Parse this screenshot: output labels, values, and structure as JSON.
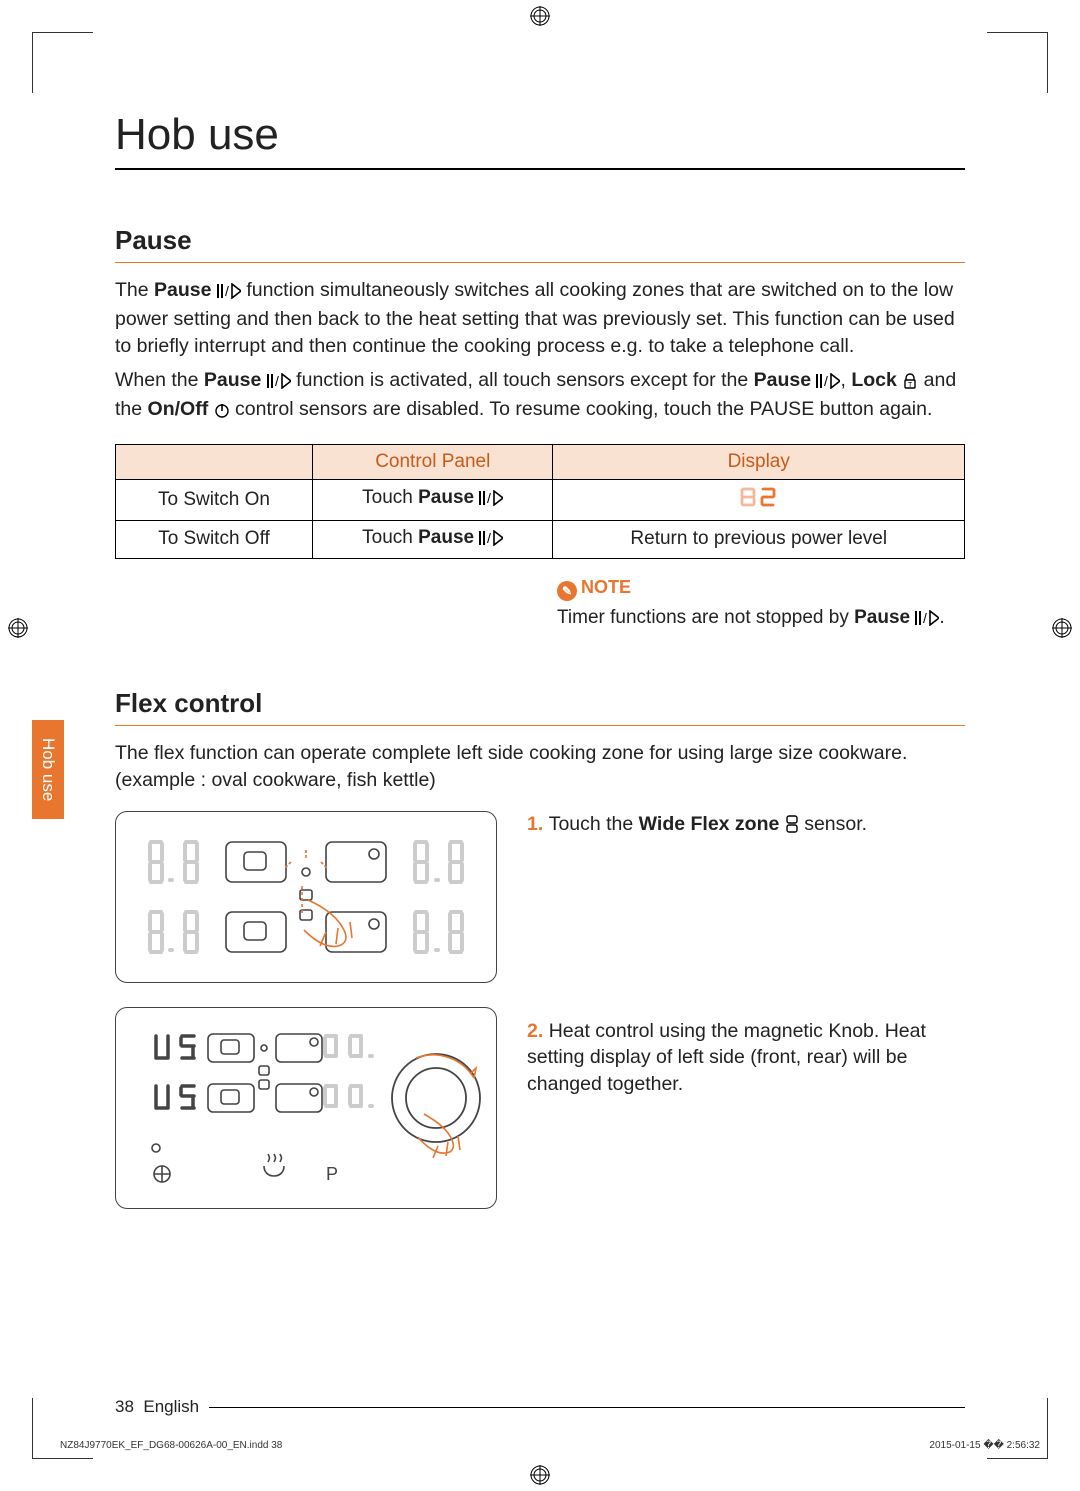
{
  "title": "Hob use",
  "sections": {
    "pause": {
      "heading": "Pause",
      "p1a": "The ",
      "p1b": "Pause",
      " p1c": " function simultaneously switches all cooking zones that are switched on to the low power setting and then back to the heat setting that was previously set. This function can be used to briefly interrupt and then continue the cooking process e.g. to take a telephone call.",
      "p2a": "When the ",
      "p2b": "Pause",
      "p2c": " function is activated, all touch sensors except for the ",
      "p2d": "Pause",
      "p2e": ", ",
      "p2f": "Lock",
      "p2g": " and the ",
      "p2h": "On/Off",
      "p2i": " control sensors are disabled. To resume cooking, touch the PAUSE button again.",
      "table": {
        "h1": "Control Panel",
        "h2": "Display",
        "r1c1": "To Switch On",
        "r1c2a": "Touch ",
        "r1c2b": "Pause",
        "r1c3": "",
        "r2c1": "To Switch Off",
        "r2c2a": "Touch ",
        "r2c2b": "Pause",
        "r2c3": "Return to previous power level"
      },
      "note_label": "NOTE",
      "note_a": "Timer functions are not stopped by ",
      "note_b": "Pause",
      "note_c": "."
    },
    "flex": {
      "heading": "Flex control",
      "p1": "The flex function can operate complete left side cooking zone for using large size cookware. (example : oval cookware, fish kettle)",
      "step1_num": "1.",
      "step1a": "Touch the ",
      "step1b": "Wide Flex zone",
      "step1c": " sensor.",
      "step2_num": "2.",
      "step2": "Heat control using the magnetic Knob. Heat setting display of left side (front, rear) will be changed together."
    }
  },
  "tab": "Hob use",
  "footer": {
    "page": "38",
    "lang": "English"
  },
  "meta": {
    "file": "NZ84J9770EK_EF_DG68-00626A-00_EN.indd   38",
    "stamp": "2015-01-15   �� 2:56:32"
  },
  "icons": {
    "pause": "||/▷",
    "lock": "lock",
    "power": "power",
    "flex": "flex",
    "seg82": "82"
  }
}
